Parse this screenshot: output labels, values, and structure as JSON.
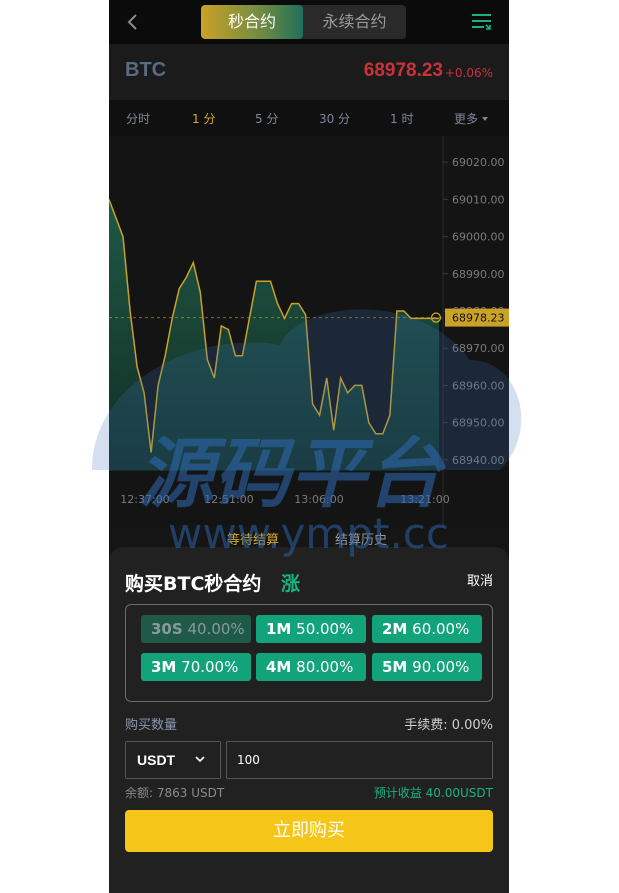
{
  "header": {
    "tabs": [
      "秒合约",
      "永续合约"
    ],
    "active_tab": 0
  },
  "ticker": {
    "symbol": "BTC",
    "price": "68978.23",
    "change": "+0.06%"
  },
  "intervals": {
    "items": [
      "分时",
      "1 分",
      "5 分",
      "30 分",
      "1 时"
    ],
    "active": 1,
    "more_label": "更多"
  },
  "chart_data": {
    "type": "area",
    "y_ticks": [
      "69020.00",
      "69010.00",
      "69000.00",
      "68990.00",
      "68980.00",
      "68970.00",
      "68960.00",
      "68950.00",
      "68940.00"
    ],
    "x_ticks": [
      "12:37:00",
      "12:51:00",
      "13:06:00",
      "13:21:00"
    ],
    "current_price_label": "68978.23",
    "ylim": [
      68937,
      69023
    ],
    "series": [
      {
        "values": [
          69010,
          69005,
          69000,
          68980,
          68965,
          68958,
          68942,
          68960,
          68968,
          68978,
          68986,
          68989,
          68993,
          68985,
          68967,
          68962,
          68976,
          68975,
          68968,
          68968,
          68978,
          68988,
          68988,
          68988,
          68982,
          68978,
          68982,
          68982,
          68979,
          68955,
          68952,
          68962,
          68948,
          68962,
          68958,
          68960,
          68960,
          68950,
          68947,
          68947,
          68952,
          68980,
          68980,
          68978,
          68978,
          68978,
          68978,
          68978
        ]
      }
    ],
    "colors": {
      "line": "#c9a227",
      "fill_top": "#1f5c48",
      "fill_bottom": "#123027"
    },
    "grid": false
  },
  "order_tabs": [
    "等待结算",
    "结算历史"
  ],
  "watermark": {
    "title": "源码平台",
    "url": "www.ympt.cc"
  },
  "sheet": {
    "title": "购买BTC秒合约",
    "direction": "涨",
    "cancel": "取消",
    "durations": [
      {
        "label": "30S",
        "rate": "40.00%"
      },
      {
        "label": "1M",
        "rate": "50.00%"
      },
      {
        "label": "2M",
        "rate": "60.00%"
      },
      {
        "label": "3M",
        "rate": "70.00%"
      },
      {
        "label": "4M",
        "rate": "80.00%"
      },
      {
        "label": "5M",
        "rate": "90.00%"
      }
    ],
    "selected_duration": 0,
    "qty_label": "购买数量",
    "fee_label": "手续费: 0.00%",
    "currency": "USDT",
    "amount": "100",
    "balance": "余额: 7863 USDT",
    "expected": "预计收益 40.00USDT",
    "buy_label": "立即购买"
  },
  "colors": {
    "accent_gold": "#d4a829",
    "up_green": "#19b37d",
    "down_red": "#c9323a",
    "buy_yellow": "#f5c518"
  }
}
